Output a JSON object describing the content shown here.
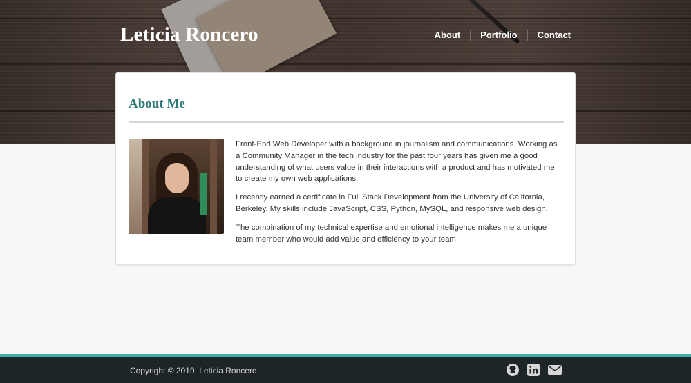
{
  "header": {
    "site_title": "Leticia Roncero",
    "nav": [
      {
        "label": "About"
      },
      {
        "label": "Portfolio"
      },
      {
        "label": "Contact"
      }
    ]
  },
  "about": {
    "heading": "About Me",
    "paragraphs": [
      "Front-End Web Developer with a background in journalism and communications. Working as a Community Manager in the tech industry for the past four years has given me a good understanding of what users value in their interactions with a product and has motivated me to create my own web applications.",
      "I recently earned a certificate in Full Stack Development from the University of California, Berkeley. My skills include JavaScript, CSS, Python, MySQL, and responsive web design.",
      "The combination of my technical expertise and emotional intelligence makes me a unique team member who would add value and efficiency to your team."
    ]
  },
  "footer": {
    "copyright": "Copyright © 2019, Leticia Roncero",
    "social_icons": [
      "github-icon",
      "linkedin-icon",
      "envelope-icon"
    ]
  },
  "colors": {
    "accent_teal": "#3aafa9",
    "heading_teal": "#2b7a78",
    "footer_bg": "#1d2528"
  }
}
